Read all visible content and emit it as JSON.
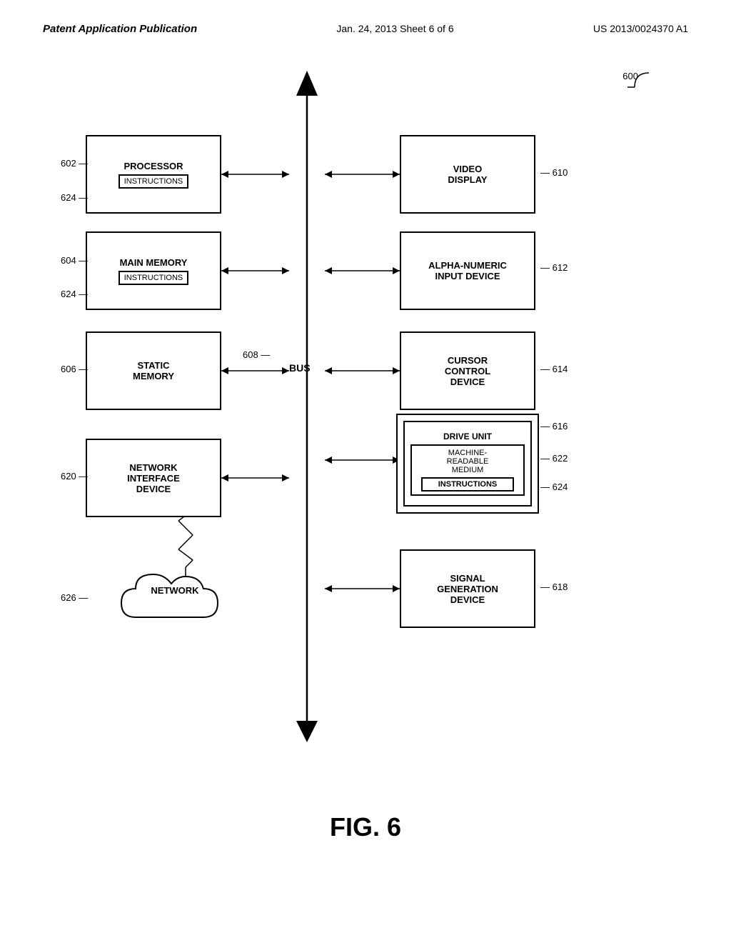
{
  "header": {
    "left": "Patent Application Publication",
    "center": "Jan. 24, 2013   Sheet 6 of 6",
    "right": "US 2013/0024370 A1"
  },
  "diagram": {
    "ref_main": "600",
    "boxes": {
      "processor": {
        "label": "PROCESSOR",
        "inner": "INSTRUCTIONS",
        "ref": "602",
        "inner_ref": "624"
      },
      "video_display": {
        "label": "VIDEO\nDISPLAY",
        "ref": "610"
      },
      "main_memory": {
        "label": "MAIN MEMORY",
        "inner": "INSTRUCTIONS",
        "ref": "604",
        "inner_ref": "624"
      },
      "alpha_numeric": {
        "label": "ALPHA-NUMERIC\nINPUT DEVICE",
        "ref": "612"
      },
      "static_memory": {
        "label": "STATIC\nMEMORY",
        "ref": "606"
      },
      "cursor_control": {
        "label": "CURSOR\nCONTROL\nDEVICE",
        "ref": "614"
      },
      "bus": {
        "label": "BUS",
        "ref": "608"
      },
      "drive_unit": {
        "label": "DRIVE UNIT",
        "ref": "616"
      },
      "machine_readable": {
        "label": "MACHINE-\nREADABLE\nMEDIUM",
        "ref": "622",
        "inner": "INSTRUCTIONS",
        "inner_ref": "624"
      },
      "network_interface": {
        "label": "NETWORK\nINTERFACE\nDEVICE",
        "ref": "620"
      },
      "signal_generation": {
        "label": "SIGNAL\nGENERATION\nDEVICE",
        "ref": "618"
      },
      "network": {
        "label": "NETWORK",
        "ref": "626"
      }
    },
    "figure": "FIG. 6"
  }
}
